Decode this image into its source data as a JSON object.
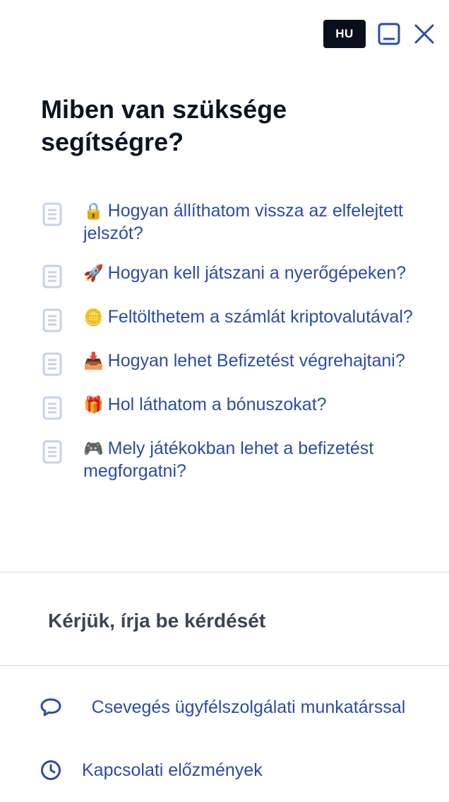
{
  "header": {
    "language": "HU",
    "icons": {
      "minimize": "minimize-icon",
      "close": "close-icon"
    }
  },
  "title": "Miben van szüksége segítségre?",
  "faq": [
    {
      "emoji": "🔒",
      "text": "Hogyan állíthatom vissza az elfelejtett jelszót?"
    },
    {
      "emoji": "🚀",
      "text": "Hogyan kell játszani a nyerőgépeken?"
    },
    {
      "emoji": "🪙",
      "text": "Feltölthetem a számlát kriptovalutával?"
    },
    {
      "emoji": "📥",
      "text": "Hogyan lehet Befizetést végrehajtani?"
    },
    {
      "emoji": "🎁",
      "text": "Hol láthatom a bónuszokat?"
    },
    {
      "emoji": "🎮",
      "text": "Mely játékokban lehet a befizetést megforgatni?"
    }
  ],
  "question_input": {
    "placeholder": "Kérjük, írja be kérdését",
    "value": ""
  },
  "footer": {
    "chat_label": "Csevegés ügyfélszolgálati munkatárssal",
    "history_label": "Kapcsolati előzmények"
  },
  "colors": {
    "accent": "#2a4ea0",
    "badge_bg": "#0a0f1c",
    "doc_icon": "#c5d2ea"
  }
}
